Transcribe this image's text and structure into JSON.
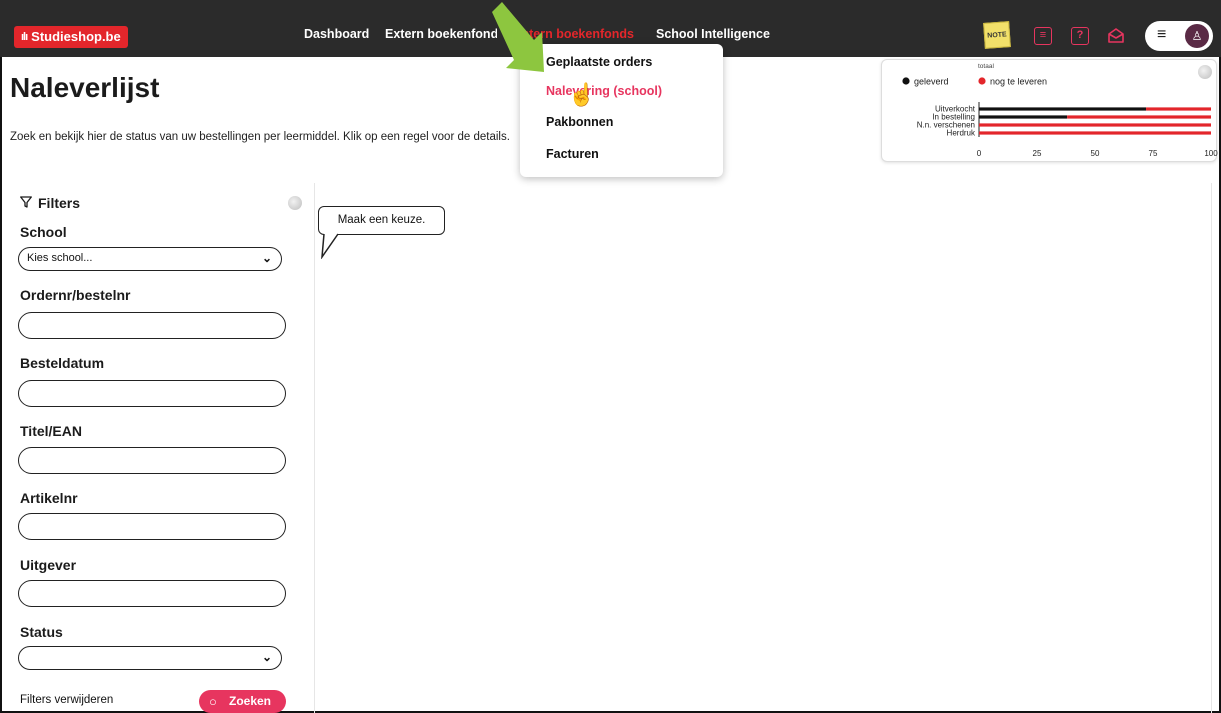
{
  "header": {
    "logo_text": "Studieshop.be",
    "logo_bars": "ılı",
    "nav": [
      "Dashboard",
      "Extern boekenfonds",
      "Intern boekenfonds",
      "School Intelligence"
    ],
    "note_label": "NOTE",
    "icons": [
      "note-icon",
      "chat-icon",
      "help-icon",
      "inbox-icon",
      "menu-icon",
      "avatar-icon"
    ]
  },
  "dropdown": {
    "items": [
      "Geplaatste orders",
      "Nalevering (school)",
      "Pakbonnen",
      "Facturen"
    ],
    "active_index": 1
  },
  "page": {
    "title": "Naleverlijst",
    "intro": "Zoek en bekijk hier de status van uw bestellingen per leermiddel. Klik op een regel voor de details."
  },
  "chart_data": {
    "type": "bar",
    "orientation": "horizontal",
    "stacked": true,
    "title": "totaal",
    "categories": [
      "Uitverkocht",
      "In bestelling",
      "N.n. verschenen",
      "Herdruk"
    ],
    "series": [
      {
        "name": "geleverd",
        "color": "#111111",
        "values": [
          72,
          38,
          0,
          0
        ]
      },
      {
        "name": "nog te leveren",
        "color": "#e3262b",
        "values": [
          28,
          62,
          100,
          100
        ]
      }
    ],
    "xlim": [
      0,
      100
    ],
    "xticks": [
      "0",
      "25",
      "50",
      "75",
      "100"
    ],
    "legend": "top-left"
  },
  "filters": {
    "heading": "Filters",
    "school_label": "School",
    "school_value": "Kies school...",
    "order_label": "Ordernr/bestelnr",
    "order_value": "",
    "date_label": "Besteldatum",
    "date_value": "",
    "title_label": "Titel/EAN",
    "title_value": "",
    "article_label": "Artikelnr",
    "article_value": "",
    "publisher_label": "Uitgever",
    "publisher_value": "",
    "status_label": "Status",
    "status_value": "",
    "remove_label": "Filters verwijderen",
    "search_label": "Zoeken"
  },
  "main": {
    "hint": "Maak een keuze."
  },
  "colors": {
    "topbar": "#2b2b2b",
    "brand_red": "#e3262b",
    "accent_pink": "#e7355f",
    "annotation_green": "#8dc63f"
  }
}
